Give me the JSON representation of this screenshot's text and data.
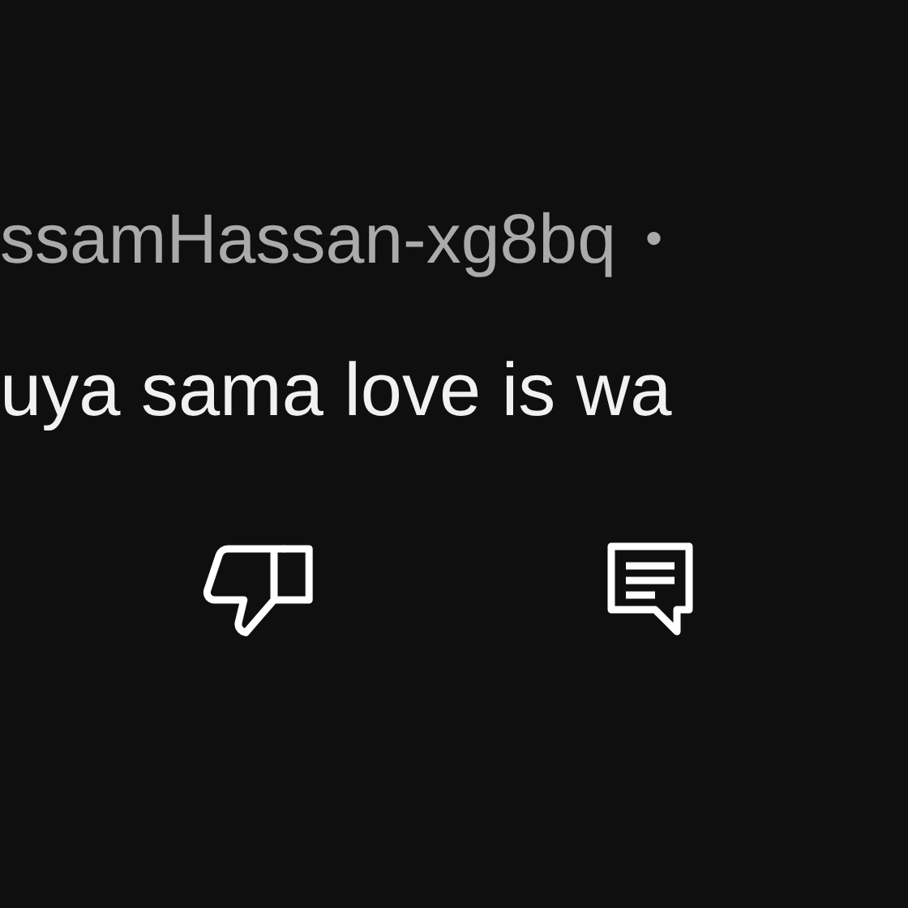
{
  "comment": {
    "author": "ssamHassan-xg8bq",
    "separator": "•",
    "text": "uya sama love is wa"
  }
}
